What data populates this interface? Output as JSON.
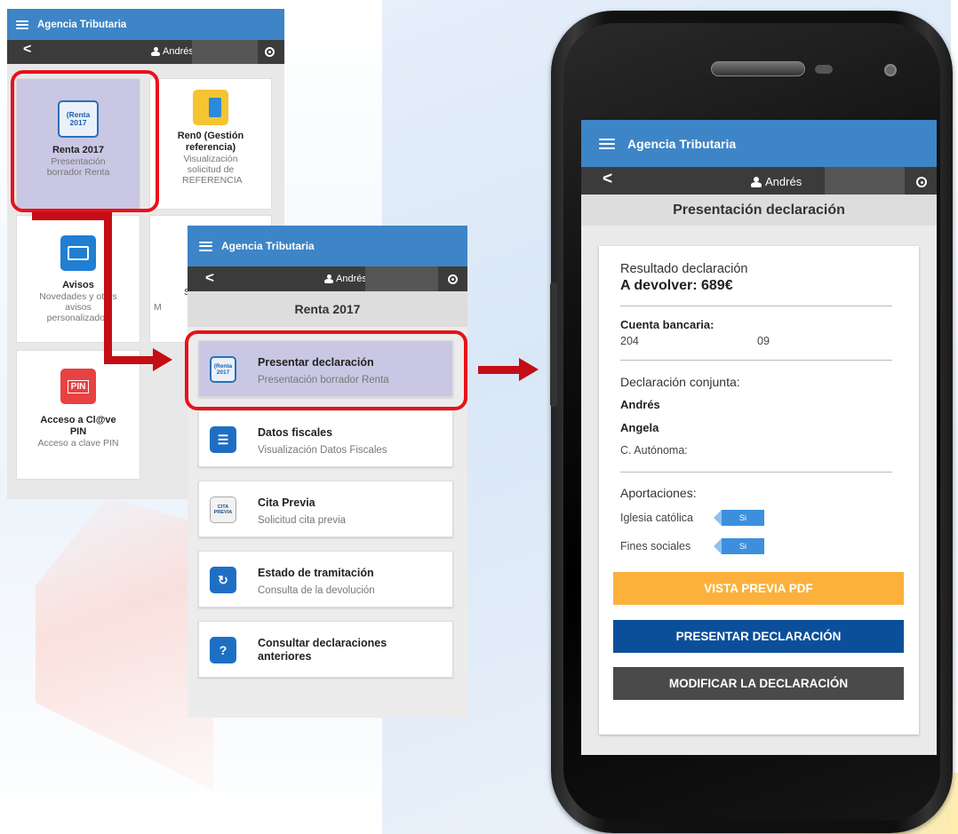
{
  "app": {
    "title": "Agencia Tributaria",
    "user_name": "Andrés"
  },
  "screen1": {
    "tiles": [
      {
        "title": "Renta 2017",
        "subtitle": "Presentación borrador Renta",
        "logo_text": "(Renta 2017",
        "icon": "renta-2017-icon"
      },
      {
        "title": "Ren0 (Gestión referencia)",
        "subtitle": "Visualización solicitud de REFERENCIA",
        "icon": "ren0-icon"
      },
      {
        "title": "Avisos",
        "subtitle": "Novedades y otros avisos personalizados",
        "icon": "envelope-icon"
      },
      {
        "title": "Acceso a Cl@ve PIN",
        "subtitle": "Acceso a clave PIN",
        "logo_text": "PIN",
        "icon": "clave-pin-icon"
      }
    ],
    "partial_tile_text_a": "S",
    "partial_tile_text_b": "M"
  },
  "screen2": {
    "header": "Renta 2017",
    "items": [
      {
        "title": "Presentar declaración",
        "subtitle": "Presentación borrador Renta",
        "icon": "renta-2017-icon",
        "logo_text": "(Renta 2017"
      },
      {
        "title": "Datos fiscales",
        "subtitle": "Visualización Datos Fiscales",
        "icon": "list-document-icon"
      },
      {
        "title": "Cita Previa",
        "subtitle": "Solicitud cita previa",
        "icon": "cita-previa-icon",
        "logo_text": "CITA PREVIA"
      },
      {
        "title": "Estado de tramitación",
        "subtitle": "Consulta de la devolución",
        "icon": "refresh-arrows-icon"
      },
      {
        "title": "Consultar declaraciones anteriores",
        "subtitle": "",
        "icon": "question-document-icon"
      }
    ]
  },
  "screen3": {
    "header": "Presentación declaración",
    "result_label": "Resultado declaración",
    "result_value": "A devolver: 689€",
    "bank_label": "Cuenta bancaria:",
    "bank_start": "204",
    "bank_end": "09",
    "joint_label": "Declaración conjunta:",
    "joint_person_1": "Andrés",
    "joint_person_2": "Angela",
    "autonomy": "C. Autónoma: ",
    "contributions_label": "Aportaciones:",
    "contrib_1": "Iglesia católica",
    "contrib_1_value": "Si",
    "contrib_2": "Fines sociales",
    "contrib_2_value": "Si",
    "btn_preview": "VISTA PREVIA PDF",
    "btn_submit": "PRESENTAR DECLARACIÓN",
    "btn_modify": "MODIFICAR LA DECLARACIÓN"
  },
  "colors": {
    "appbar": "#3d85c6",
    "userbar": "#3b3b3b",
    "highlight": "#e8111a",
    "btn_preview": "#fbb13c",
    "btn_submit": "#0b4f9a",
    "btn_modify": "#4a4a4a"
  }
}
